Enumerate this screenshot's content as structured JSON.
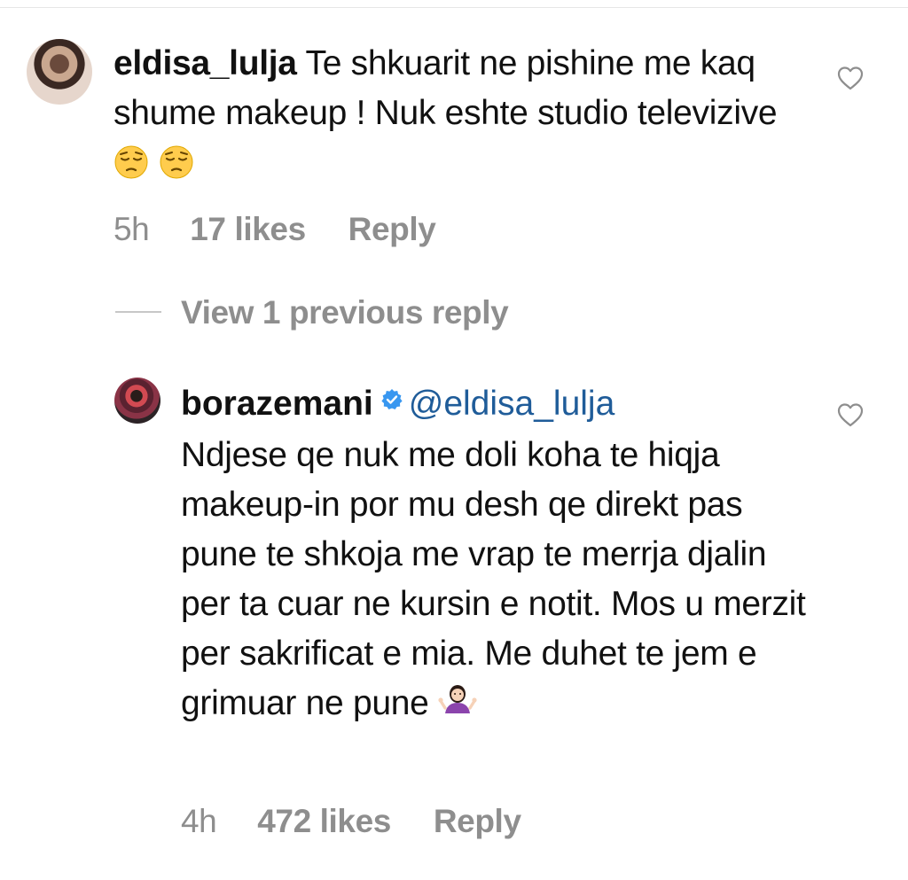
{
  "comments": [
    {
      "username": "eldisa_lulja",
      "text": "Te shkuarit ne pishine me  kaq shume makeup ! Nuk eshte studio televizive",
      "emoji_icons": [
        "pensive-face-icon",
        "pensive-face-icon"
      ],
      "time": "5h",
      "likes": "17 likes",
      "reply_label": "Reply"
    },
    {
      "username": "borazemani",
      "verified": true,
      "mention": "@eldisa_lulja",
      "text": "Ndjese qe nuk me doli koha te hiqja makeup-in por mu desh qe direkt pas pune te shkoja me vrap te merrja djalin per ta cuar ne kursin e notit. Mos u merzit per sakrificat e mia. Me duhet te jem e grimuar ne pune",
      "emoji_icons": [
        "woman-shrugging-icon"
      ],
      "time": "4h",
      "likes": "472 likes",
      "reply_label": "Reply"
    }
  ],
  "view_replies_label": "View 1 previous reply",
  "colors": {
    "text": "#111111",
    "muted": "#8e8e8e",
    "mention": "#1f5c99",
    "verified": "#3897f0"
  }
}
